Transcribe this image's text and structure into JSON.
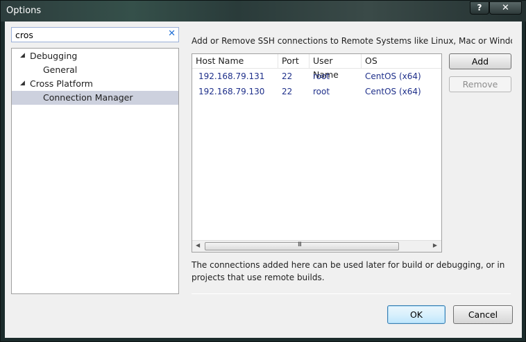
{
  "window": {
    "title": "Options",
    "help_label": "?",
    "close_label": "✕"
  },
  "search": {
    "value": "cros",
    "clear_label": "✕"
  },
  "tree": {
    "items": [
      {
        "label": "Debugging",
        "expanded": true
      },
      {
        "label": "General"
      },
      {
        "label": "Cross Platform",
        "expanded": true
      },
      {
        "label": "Connection Manager",
        "selected": true
      }
    ],
    "expanded_arrow": "◢"
  },
  "main": {
    "description": "Add or Remove SSH connections to Remote Systems like Linux, Mac or Windows",
    "columns": [
      "Host Name",
      "Port",
      "User Name",
      "OS"
    ],
    "rows": [
      {
        "host": "192.168.79.131",
        "port": "22",
        "user": "root",
        "os": "CentOS (x64)"
      },
      {
        "host": "192.168.79.130",
        "port": "22",
        "user": "root",
        "os": "CentOS (x64)"
      }
    ],
    "scroll_grip": "III",
    "scroll_left": "◀",
    "scroll_right": "▶",
    "add_label": "Add",
    "remove_label": "Remove",
    "note": "The connections added here can be used later for build or debugging, or in projects that use remote builds."
  },
  "footer": {
    "ok_label": "OK",
    "cancel_label": "Cancel"
  }
}
